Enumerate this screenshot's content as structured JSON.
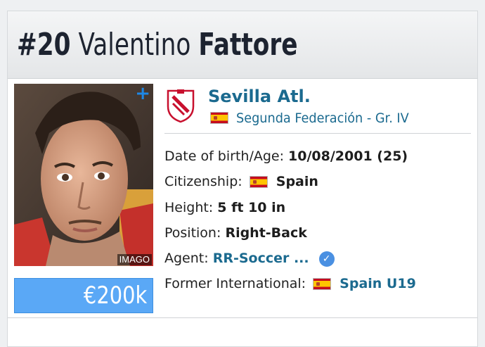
{
  "header": {
    "number": "#20",
    "first_name": "Valentino",
    "last_name": "Fattore"
  },
  "photo": {
    "watermark": "IMAGO",
    "plus_icon": "plus-icon"
  },
  "market_value": "€200k",
  "club": {
    "name": "Sevilla Atl.",
    "logo_icon": "club-crest-icon",
    "league": "Segunda Federación - Gr. IV",
    "league_flag": "spain-flag-icon"
  },
  "details": {
    "dob_label": "Date of birth/Age:",
    "dob_value": "10/08/2001 (25)",
    "citizenship_label": "Citizenship:",
    "citizenship_value": "Spain",
    "height_label": "Height:",
    "height_value": "5 ft 10 in",
    "position_label": "Position:",
    "position_value": "Right-Back",
    "agent_label": "Agent:",
    "agent_value": "RR-Soccer ...",
    "agent_verified_icon": "verified-check-icon",
    "former_int_label": "Former International:",
    "former_int_value": "Spain U19"
  },
  "colors": {
    "link": "#1b6a8f",
    "value_box": "#5aa8f6",
    "plus": "#1e88e5"
  }
}
